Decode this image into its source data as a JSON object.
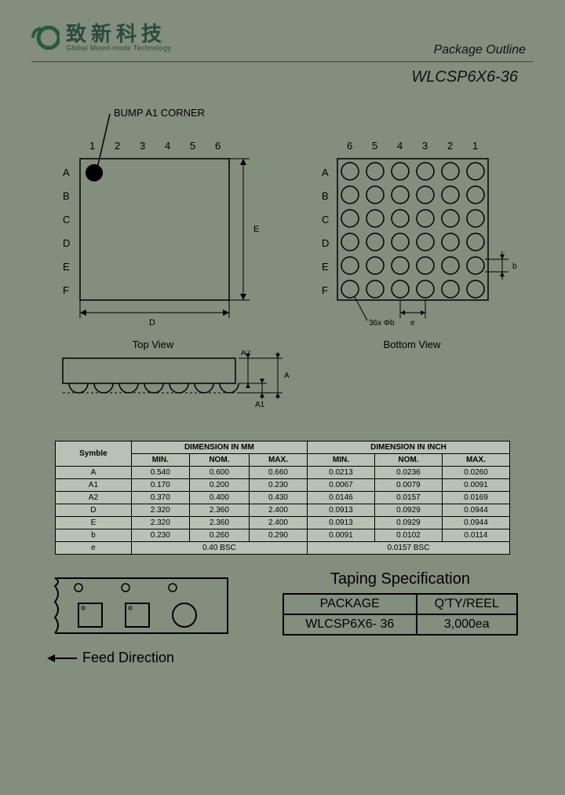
{
  "header": {
    "chinese": "致新科技",
    "english": "Global Mixed-mode Technology",
    "page_title": "Package Outline"
  },
  "part_number": "WLCSP6X6-36",
  "topview": {
    "callout": "BUMP A1 CORNER",
    "cols": [
      "1",
      "2",
      "3",
      "4",
      "5",
      "6"
    ],
    "rows": [
      "A",
      "B",
      "C",
      "D",
      "E",
      "F"
    ],
    "dim_d": "D",
    "dim_e": "E",
    "label": "Top View"
  },
  "bottomview": {
    "cols": [
      "6",
      "5",
      "4",
      "3",
      "2",
      "1"
    ],
    "rows": [
      "A",
      "B",
      "C",
      "D",
      "E",
      "F"
    ],
    "count_note": "36x Φb",
    "dim_e": "e",
    "dim_b": "b",
    "label": "Bottom View"
  },
  "sideview": {
    "dims": [
      "A",
      "A1",
      "A2"
    ]
  },
  "dim_table": {
    "symbol_hdr": "Symble",
    "mm_hdr": "DIMENSION IN MM",
    "in_hdr": "DIMENSION IN INCH",
    "subhdr": [
      "MIN.",
      "NOM.",
      "MAX.",
      "MIN.",
      "NOM.",
      "MAX."
    ],
    "rows": [
      {
        "s": "A",
        "v": [
          "0.540",
          "0.600",
          "0.660",
          "0.0213",
          "0.0236",
          "0.0260"
        ]
      },
      {
        "s": "A1",
        "v": [
          "0.170",
          "0.200",
          "0.230",
          "0.0067",
          "0.0079",
          "0.0091"
        ]
      },
      {
        "s": "A2",
        "v": [
          "0.370",
          "0.400",
          "0.430",
          "0.0146",
          "0.0157",
          "0.0169"
        ]
      },
      {
        "s": "D",
        "v": [
          "2.320",
          "2.360",
          "2.400",
          "0.0913",
          "0.0929",
          "0.0944"
        ]
      },
      {
        "s": "E",
        "v": [
          "2.320",
          "2.360",
          "2.400",
          "0.0913",
          "0.0929",
          "0.0944"
        ]
      },
      {
        "s": "b",
        "v": [
          "0.230",
          "0.260",
          "0.290",
          "0.0091",
          "0.0102",
          "0.0114"
        ]
      }
    ],
    "bsc_row": {
      "s": "e",
      "mm": "0.40 BSC",
      "in": "0.0157 BSC"
    }
  },
  "taping": {
    "title": "Taping Specification",
    "hdr": [
      "PACKAGE",
      "Q'TY/REEL"
    ],
    "row": [
      "WLCSP6X6- 36",
      "3,000ea"
    ],
    "feed": "Feed  Direction"
  }
}
